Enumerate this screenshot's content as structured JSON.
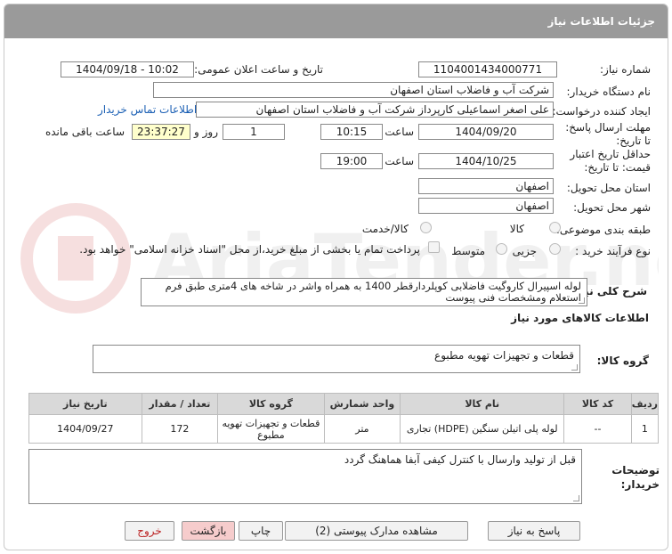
{
  "header": {
    "title": "جزئیات اطلاعات نیاز"
  },
  "fields": {
    "need_number_label": "شماره نیاز:",
    "need_number": "1104001434000771",
    "announce_label": "تاریخ و ساعت اعلان عمومی:",
    "announce_value": "1404/09/18 - 10:02",
    "buyer_label": "نام دستگاه خریدار:",
    "buyer": "شرکت آب و فاضلاب استان اصفهان",
    "creator_label": "ایجاد کننده درخواست:",
    "creator": "علی اصغر اسماعیلی کارپرداز شرکت آب و فاضلاب استان اصفهان",
    "contact_link": "اطلاعات تماس خریدار",
    "reply_deadline_label": "مهلت ارسال پاسخ: تا تاریخ:",
    "reply_date": "1404/09/20",
    "time_label": "ساعت",
    "reply_time": "10:15",
    "days_value": "1",
    "days_label": "روز و",
    "remaining_time": "23:37:27",
    "remaining_label": "ساعت باقی مانده",
    "validity_label": "حداقل تاریخ اعتبار قیمت: تا تاریخ:",
    "validity_date": "1404/10/25",
    "validity_time_label": "ساعت",
    "validity_time": "19:00",
    "province_label": "استان محل تحویل:",
    "province": "اصفهان",
    "city_label": "شهر محل تحویل:",
    "city": "اصفهان",
    "category_label": "طبقه بندی موضوعی:",
    "category_options": [
      "کالا",
      "کالا/خدمت"
    ],
    "process_label": "نوع فرآیند خرید :",
    "process_options": [
      "جزیی",
      "متوسط"
    ],
    "payment_note": "پرداخت تمام یا بخشی از مبلغ خرید،از محل \"اسناد خزانه اسلامی\" خواهد بود."
  },
  "description": {
    "label": "شرح کلی نیاز:",
    "text": "لوله اسپیرال کاروگیت فاضلابی کوپلردارقطر 1400 به همراه واشر در شاخه های 4متری طبق فرم استعلام ومشخصات فنی پیوست"
  },
  "goods": {
    "section_title": "اطلاعات کالاهای مورد نیاز",
    "group_label": "گروه کالا:",
    "group_value": "قطعات و تجهیزات تهویه مطبوع",
    "columns": [
      "ردیف",
      "کد کالا",
      "نام کالا",
      "واحد شمارش",
      "گروه کالا",
      "تعداد / مقدار",
      "تاریخ نیاز"
    ],
    "rows": [
      {
        "index": "1",
        "code": "--",
        "name": "لوله پلی اتیلن سنگین (HDPE) تجاری",
        "unit": "متر",
        "group": "قطعات و تجهیزات تهویه مطبوع",
        "qty": "172",
        "date": "1404/09/27"
      }
    ]
  },
  "buyer_notes": {
    "label": "توضیحات خریدار:",
    "text": "قبل از تولید وارسال با کنترل کیفی آبفا هماهنگ گردد"
  },
  "buttons": {
    "reply": "پاسخ به نیاز",
    "docs": "مشاهده مدارک پیوستی (2)",
    "print": "چاپ",
    "back": "بازگشت",
    "exit": "خروج"
  },
  "colors": {
    "header_bg": "#9a9a9a",
    "highlight": "#ffffcc",
    "link": "#1a5fb4",
    "exit_red": "#b22222"
  }
}
